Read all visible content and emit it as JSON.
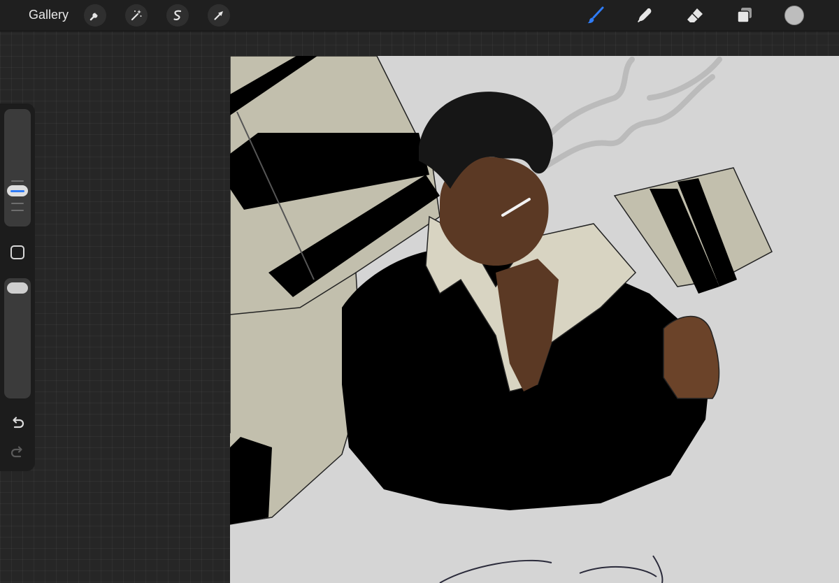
{
  "topbar": {
    "gallery_label": "Gallery",
    "left_tools": [
      {
        "name": "actions",
        "icon": "wrench-icon"
      },
      {
        "name": "adjustments",
        "icon": "magic-wand-icon"
      },
      {
        "name": "selection",
        "icon": "selection-s-icon"
      },
      {
        "name": "transform",
        "icon": "arrow-cursor-icon"
      }
    ],
    "right_tools": [
      {
        "name": "brush",
        "icon": "paintbrush-icon",
        "active": true,
        "color": "#2f7cf6"
      },
      {
        "name": "smudge",
        "icon": "smudge-finger-icon",
        "active": false
      },
      {
        "name": "eraser",
        "icon": "eraser-icon",
        "active": false
      },
      {
        "name": "layers",
        "icon": "layers-icon",
        "active": false
      }
    ],
    "current_color": "#bdbdbd"
  },
  "sidebar": {
    "brush_size_level": 0.38,
    "brush_opacity_level": 1.0,
    "accent_color": "#2f7cf6",
    "modify_icon": "square-modify-icon",
    "undo_icon": "undo-arrow-icon",
    "redo_icon": "redo-arrow-icon"
  },
  "canvas": {
    "background_color": "#d5d5d5",
    "content": "illustration"
  }
}
